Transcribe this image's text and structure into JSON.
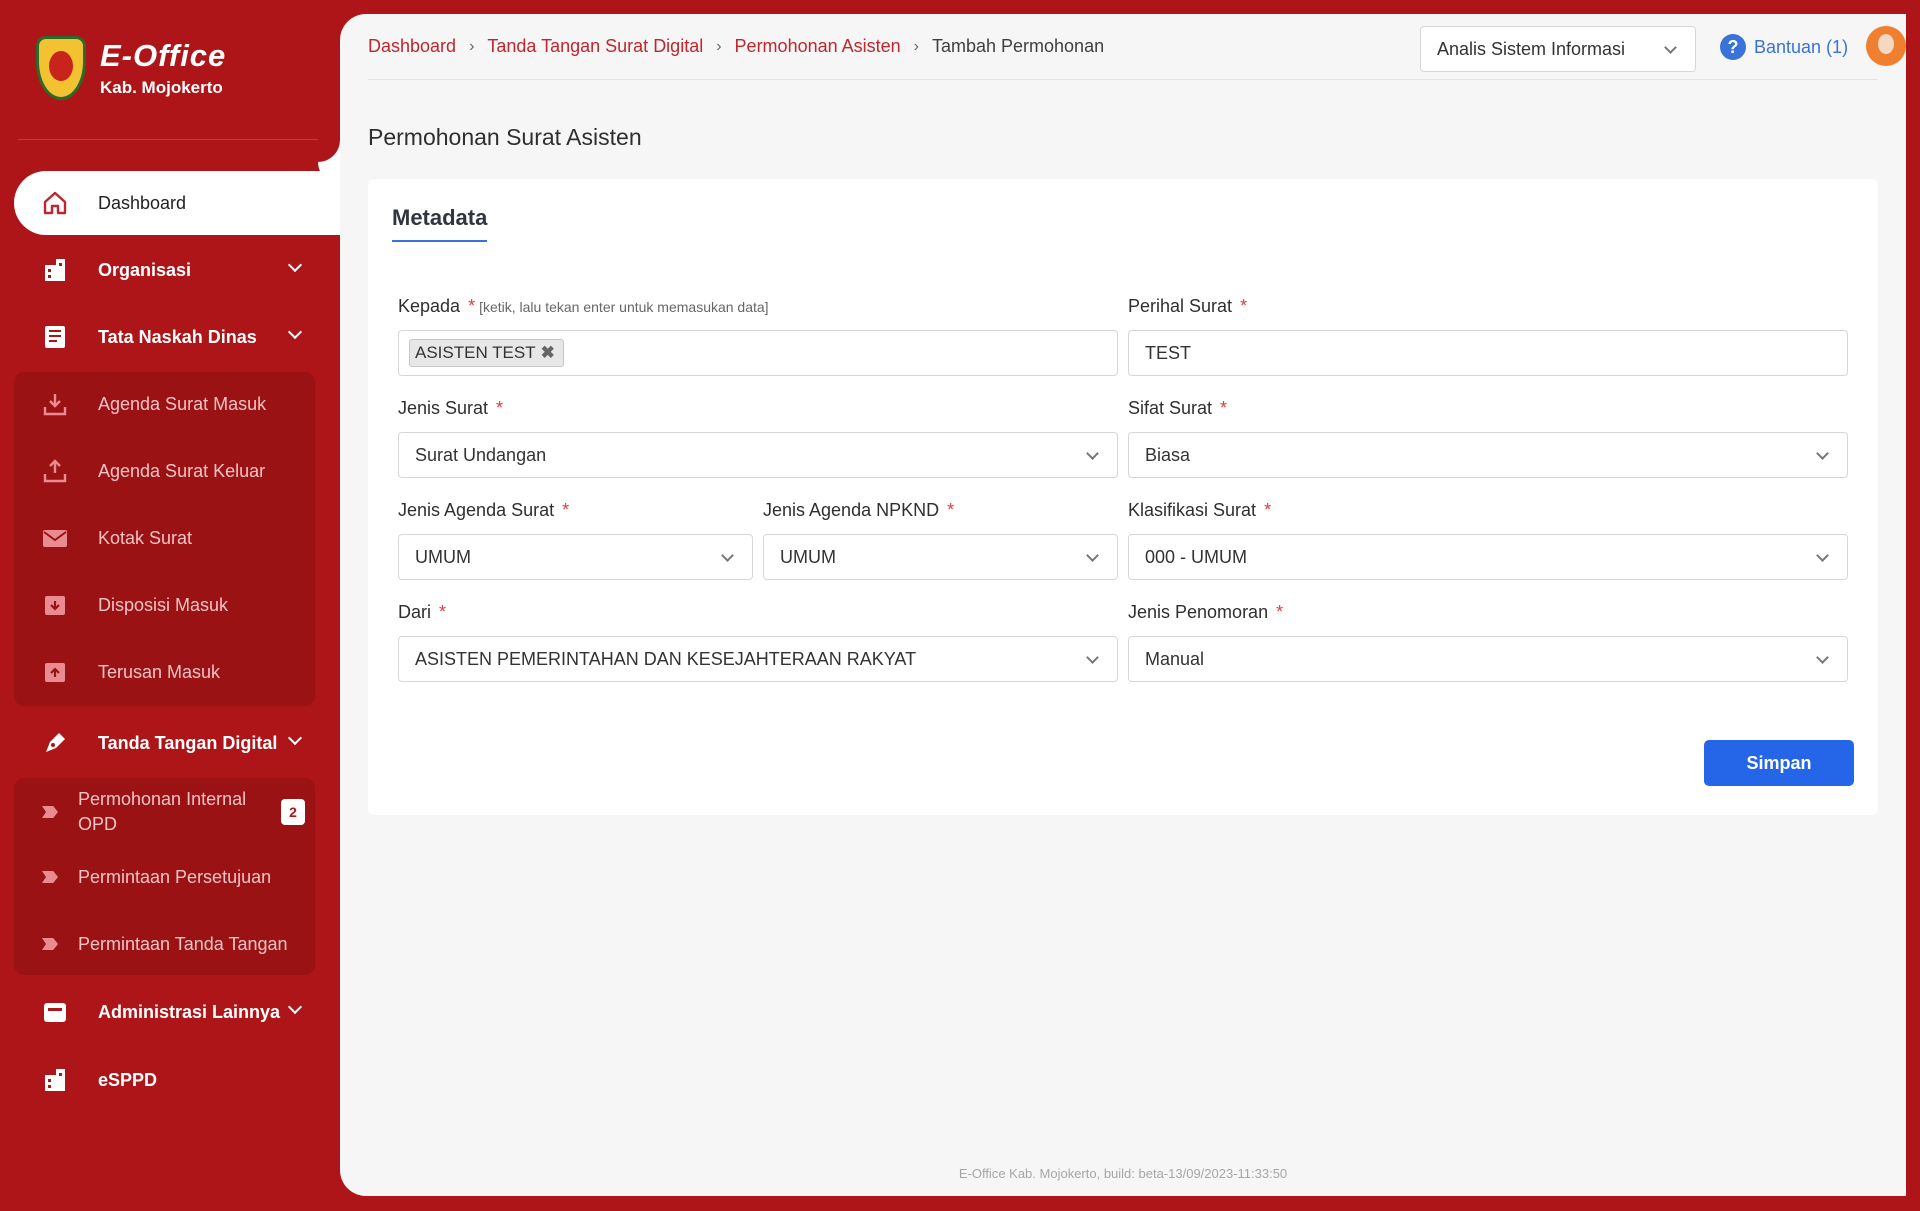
{
  "app": {
    "title": "E-Office",
    "subtitle": "Kab. Mojokerto"
  },
  "sidebar": {
    "items": [
      {
        "label": "Dashboard",
        "icon": "home-icon",
        "active": true
      },
      {
        "label": "Organisasi",
        "icon": "building-icon"
      },
      {
        "label": "Tata Naskah Dinas",
        "icon": "book-icon"
      },
      {
        "label": "Agenda Surat Masuk",
        "icon": "download-tray-icon"
      },
      {
        "label": "Agenda Surat Keluar",
        "icon": "upload-tray-icon"
      },
      {
        "label": "Kotak Surat",
        "icon": "mail-icon"
      },
      {
        "label": "Disposisi Masuk",
        "icon": "inbox-down-icon"
      },
      {
        "label": "Terusan Masuk",
        "icon": "inbox-up-icon"
      },
      {
        "label": "Tanda Tangan Digital",
        "icon": "pen-icon"
      },
      {
        "label": "Permohonan Internal OPD",
        "icon": "tag-icon",
        "badge": "2"
      },
      {
        "label": "Permintaan Persetujuan",
        "icon": "tag-icon"
      },
      {
        "label": "Permintaan Tanda Tangan",
        "icon": "tag-icon"
      },
      {
        "label": "Administrasi Lainnya",
        "icon": "archive-icon"
      },
      {
        "label": "eSPPD",
        "icon": "building-icon"
      }
    ]
  },
  "breadcrumb": [
    "Dashboard",
    "Tanda Tangan Surat Digital",
    "Permohonan Asisten",
    "Tambah Permohonan"
  ],
  "header": {
    "role": "Analis Sistem Informasi",
    "help": "Bantuan (1)"
  },
  "page": {
    "title": "Permohonan Surat Asisten",
    "tab": "Metadata"
  },
  "form": {
    "kepada": {
      "label": "Kepada",
      "hint": "[ketik, lalu tekan enter untuk memasukan data]",
      "chip": "ASISTEN TEST"
    },
    "perihal": {
      "label": "Perihal Surat",
      "value": "TEST"
    },
    "jenis_surat": {
      "label": "Jenis Surat",
      "value": "Surat Undangan"
    },
    "sifat_surat": {
      "label": "Sifat Surat",
      "value": "Biasa"
    },
    "jenis_agenda": {
      "label": "Jenis Agenda Surat",
      "value": "UMUM"
    },
    "jenis_npknd": {
      "label": "Jenis Agenda NPKND",
      "value": "UMUM"
    },
    "klasifikasi": {
      "label": "Klasifikasi Surat",
      "value": "000 - UMUM"
    },
    "dari": {
      "label": "Dari",
      "value": "ASISTEN PEMERINTAHAN DAN KESEJAHTERAAN RAKYAT"
    },
    "penomoran": {
      "label": "Jenis Penomoran",
      "value": "Manual"
    },
    "required_mark": "*",
    "submit": "Simpan"
  },
  "footer": "E-Office Kab. Mojokerto, build: beta-13/09/2023-11:33:50",
  "colors": {
    "brand_red": "#ae1519",
    "accent_blue": "#2566e8",
    "link_blue": "#3a72d9"
  }
}
